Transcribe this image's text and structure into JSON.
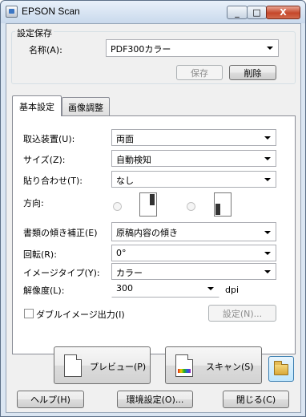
{
  "window": {
    "title": "EPSON Scan",
    "minimize": "_",
    "maximize": "□",
    "close": "X"
  },
  "preset": {
    "group_label": "設定保存",
    "name_label": "名称(A):",
    "name_value": "PDF300カラー",
    "save_button": "保存",
    "delete_button": "削除"
  },
  "tabs": [
    {
      "label": "基本設定",
      "active": true
    },
    {
      "label": "画像調整",
      "active": false
    }
  ],
  "basic": {
    "source_label": "取込装置(U):",
    "source_value": "両面",
    "size_label": "サイズ(Z):",
    "size_value": "自動検知",
    "stitch_label": "貼り合わせ(T):",
    "stitch_value": "なし",
    "orientation_label": "方向:",
    "skew_label": "書類の傾き補正(E)",
    "skew_value": "原稿内容の傾き",
    "rotate_label": "回転(R):",
    "rotate_value": "0°",
    "image_type_label": "イメージタイプ(Y):",
    "image_type_value": "カラー",
    "resolution_label": "解像度(L):",
    "resolution_value": "300",
    "resolution_unit": "dpi",
    "double_feed_label": "ダブルイメージ出力(I)",
    "double_feed_checked": false,
    "settings_button": "設定(N)..."
  },
  "actions": {
    "preview_button": "プレビュー(P)",
    "scan_button": "スキャン(S)"
  },
  "footer": {
    "help_button": "ヘルプ(H)",
    "config_button": "環境設定(O)...",
    "close_button": "閉じる(C)"
  },
  "icons": {
    "app": "epson-scan-icon",
    "preview": "document-icon",
    "scan": "scan-document-icon",
    "folder": "folder-icon"
  }
}
